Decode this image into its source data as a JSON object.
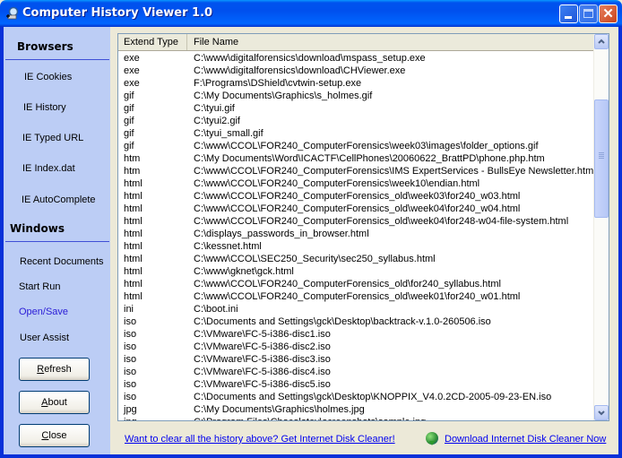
{
  "window": {
    "title": "Computer History Viewer 1.0",
    "controls": {
      "minimize": "_",
      "maximize": "□",
      "close": "✕"
    }
  },
  "sidebar": {
    "browsers_title": "Browsers",
    "browser_items": [
      {
        "label": "IE Cookies"
      },
      {
        "label": "IE History"
      },
      {
        "label": "IE Typed URL"
      },
      {
        "label": "IE Index.dat"
      },
      {
        "label": "IE AutoComplete"
      }
    ],
    "windows_title": "Windows",
    "windows_items": [
      {
        "label": "Recent Documents",
        "active": false
      },
      {
        "label": "Start Run",
        "active": false
      },
      {
        "label": "Open/Save",
        "active": true
      },
      {
        "label": "User Assist",
        "active": false
      }
    ],
    "buttons": {
      "refresh": {
        "accel": "R",
        "rest": "efresh"
      },
      "about": {
        "accel": "A",
        "rest": "bout"
      },
      "close": {
        "accel": "C",
        "rest": "lose"
      }
    }
  },
  "list": {
    "columns": [
      "Extend Type",
      "File Name"
    ],
    "rows": [
      [
        "exe",
        "C:\\www\\digitalforensics\\download\\mspass_setup.exe"
      ],
      [
        "exe",
        "C:\\www\\digitalforensics\\download\\CHViewer.exe"
      ],
      [
        "exe",
        "F:\\Programs\\DShield\\cvtwin-setup.exe"
      ],
      [
        "gif",
        "C:\\My Documents\\Graphics\\s_holmes.gif"
      ],
      [
        "gif",
        "C:\\tyui.gif"
      ],
      [
        "gif",
        "C:\\tyui2.gif"
      ],
      [
        "gif",
        "C:\\tyui_small.gif"
      ],
      [
        "gif",
        "C:\\www\\CCOL\\FOR240_ComputerForensics\\week03\\images\\folder_options.gif"
      ],
      [
        "htm",
        "C:\\My Documents\\Word\\ICACTF\\CellPhones\\20060622_BrattPD\\phone.php.htm"
      ],
      [
        "htm",
        "C:\\www\\CCOL\\FOR240_ComputerForensics\\IMS ExpertServices - BullsEye Newsletter.htm"
      ],
      [
        "html",
        "C:\\www\\CCOL\\FOR240_ComputerForensics\\week10\\endian.html"
      ],
      [
        "html",
        "C:\\www\\CCOL\\FOR240_ComputerForensics_old\\week03\\for240_w03.html"
      ],
      [
        "html",
        "C:\\www\\CCOL\\FOR240_ComputerForensics_old\\week04\\for240_w04.html"
      ],
      [
        "html",
        "C:\\www\\CCOL\\FOR240_ComputerForensics_old\\week04\\for248-w04-file-system.html"
      ],
      [
        "html",
        "C:\\displays_passwords_in_browser.html"
      ],
      [
        "html",
        "C:\\kessnet.html"
      ],
      [
        "html",
        "C:\\www\\CCOL\\SEC250_Security\\sec250_syllabus.html"
      ],
      [
        "html",
        "C:\\www\\gknet\\gck.html"
      ],
      [
        "html",
        "C:\\www\\CCOL\\FOR240_ComputerForensics_old\\for240_syllabus.html"
      ],
      [
        "html",
        "C:\\www\\CCOL\\FOR240_ComputerForensics_old\\week01\\for240_w01.html"
      ],
      [
        "ini",
        "C:\\boot.ini"
      ],
      [
        "iso",
        "C:\\Documents and Settings\\gck\\Desktop\\backtrack-v.1.0-260506.iso"
      ],
      [
        "iso",
        "C:\\VMware\\FC-5-i386-disc1.iso"
      ],
      [
        "iso",
        "C:\\VMware\\FC-5-i386-disc2.iso"
      ],
      [
        "iso",
        "C:\\VMware\\FC-5-i386-disc3.iso"
      ],
      [
        "iso",
        "C:\\VMware\\FC-5-i386-disc4.iso"
      ],
      [
        "iso",
        "C:\\VMware\\FC-5-i386-disc5.iso"
      ],
      [
        "iso",
        "C:\\Documents and Settings\\gck\\Desktop\\KNOPPIX_V4.0.2CD-2005-09-23-EN.iso"
      ],
      [
        "jpg",
        "C:\\My Documents\\Graphics\\holmes.jpg"
      ],
      [
        "jpg",
        "C:\\Program Files\\Chocolatey\\screenshots\\sample.jpg"
      ]
    ]
  },
  "footer": {
    "clear_link": "Want to clear all the history above? Get Internet Disk Cleaner!",
    "download_link": "Download Internet Disk Cleaner Now"
  }
}
